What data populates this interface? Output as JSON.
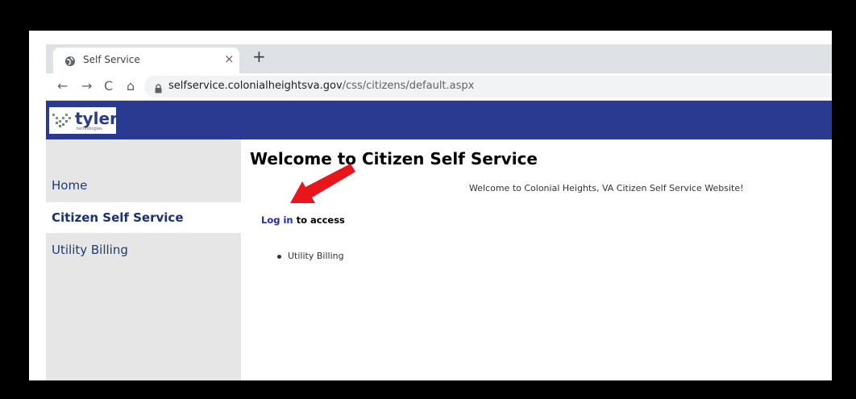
{
  "browser": {
    "tab_title": "Self Service",
    "tab_close": "×",
    "new_tab": "+",
    "url_host": "selfservice.colonialheightsva.gov",
    "url_path": "/css/citizens/default.aspx",
    "nav": {
      "back": "←",
      "forward": "→",
      "reload": "C",
      "home": "⌂"
    }
  },
  "site": {
    "logo_text": "tyler",
    "logo_subtext": "technologies",
    "sidebar": [
      {
        "label": "Home",
        "active": false
      },
      {
        "label": "Citizen Self Service",
        "active": true
      },
      {
        "label": "Utility Billing",
        "active": false
      }
    ],
    "heading": "Welcome to Citizen Self Service",
    "welcome_message": "Welcome to Colonial Heights, VA Citizen Self Service Website!",
    "login_link": "Log in",
    "login_suffix": " to access",
    "access_items": [
      "Utility Billing"
    ]
  },
  "colors": {
    "header": "#2b3a91",
    "sidebar": "#e6e6e6",
    "annotation_arrow": "#e8151b"
  }
}
